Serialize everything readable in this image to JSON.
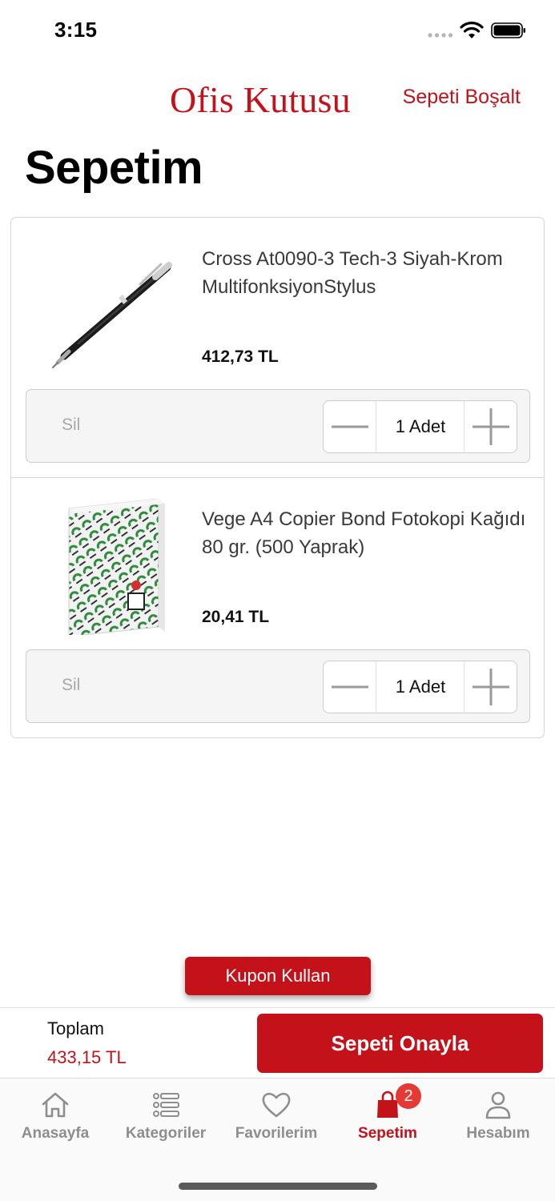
{
  "status_bar": {
    "time": "3:15"
  },
  "header": {
    "brand": "Ofis Kutusu",
    "empty_cart": "Sepeti Boşalt"
  },
  "page": {
    "title": "Sepetim"
  },
  "cart": {
    "items": [
      {
        "name": "Cross At0090-3 Tech-3 Siyah-Krom MultifonksiyonStylus",
        "price": "412,73 TL",
        "remove": "Sil",
        "quantity": "1 Adet",
        "image": "pen-image"
      },
      {
        "name": "Vege A4 Copier Bond Fotokopi Kağıdı 80 gr. (500 Yaprak)",
        "price": "20,41 TL",
        "remove": "Sil",
        "quantity": "1 Adet",
        "image": "paper-ream-image"
      }
    ]
  },
  "coupon": {
    "label": "Kupon Kullan"
  },
  "checkout": {
    "total_label": "Toplam",
    "total_value": "433,15 TL",
    "confirm_label": "Sepeti Onayla"
  },
  "tabs": [
    {
      "label": "Anasayfa",
      "icon": "home-icon"
    },
    {
      "label": "Kategoriler",
      "icon": "list-icon"
    },
    {
      "label": "Favorilerim",
      "icon": "heart-icon"
    },
    {
      "label": "Sepetim",
      "icon": "bag-icon",
      "badge": "2",
      "active": true
    },
    {
      "label": "Hesabım",
      "icon": "user-icon"
    }
  ],
  "colors": {
    "brand_red": "#c4121b",
    "badge_red": "#e53935",
    "tab_gray": "#8e8e8e"
  }
}
